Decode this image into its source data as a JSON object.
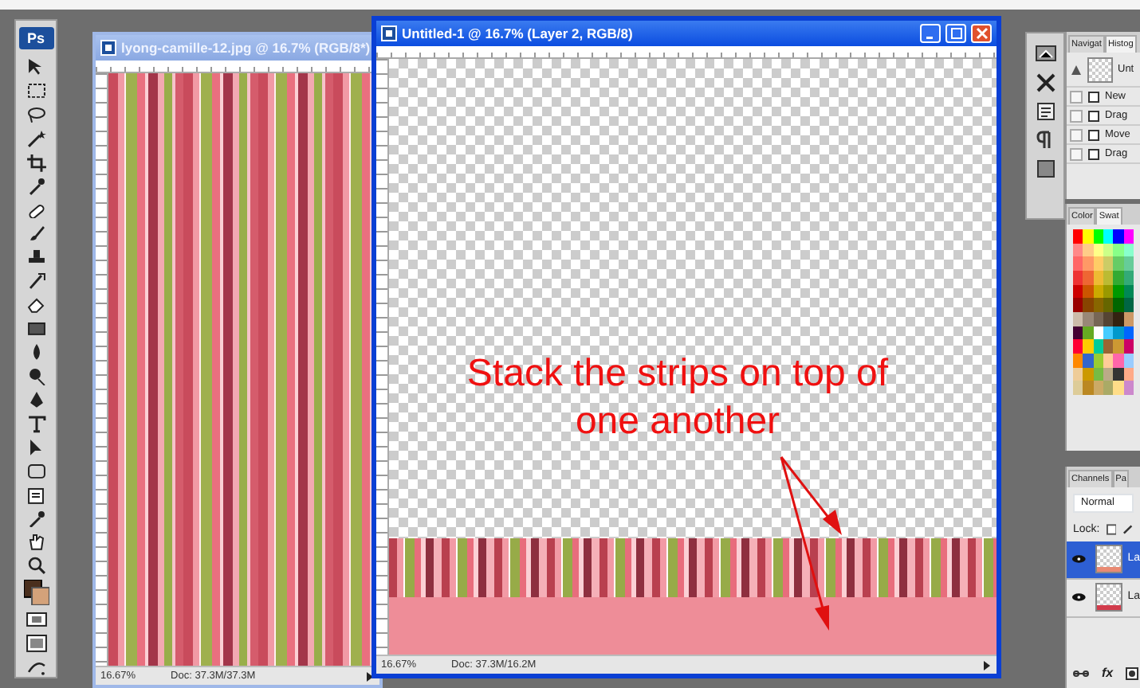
{
  "toolbox": {
    "logo": "Ps"
  },
  "documents": [
    {
      "title": "lyong-camille-12.jpg @ 16.7% (RGB/8*)",
      "active": false,
      "zoom": "16.67%",
      "doc_size": "Doc: 37.3M/37.3M"
    },
    {
      "title": "Untitled-1 @ 16.7% (Layer 2, RGB/8)",
      "active": true,
      "zoom": "16.67%",
      "doc_size": "Doc: 37.3M/16.2M"
    }
  ],
  "navigator_panel": {
    "tabs": [
      {
        "label": "Navigat",
        "selected": false
      },
      {
        "label": "Histog",
        "selected": true
      }
    ],
    "snapshot": "Unt",
    "history": [
      {
        "label": "New",
        "checked": false
      },
      {
        "label": "Drag",
        "checked": false
      },
      {
        "label": "Move",
        "checked": false
      },
      {
        "label": "Drag",
        "checked": false
      }
    ]
  },
  "color_panel": {
    "tabs": [
      {
        "label": "Color",
        "selected": false
      },
      {
        "label": "Swat",
        "selected": true
      }
    ]
  },
  "layers_panel": {
    "tabs": [
      {
        "label": "Channels",
        "selected": false
      },
      {
        "label": "Pa",
        "selected": false
      }
    ],
    "blend_mode": "Normal",
    "lock_label": "Lock:",
    "style_button": "fx",
    "layers": [
      {
        "name": "La",
        "selected": true,
        "visible": true
      },
      {
        "name": "La",
        "selected": false,
        "visible": true
      }
    ]
  },
  "annotation": {
    "text": "Stack the strips on top of one another"
  }
}
